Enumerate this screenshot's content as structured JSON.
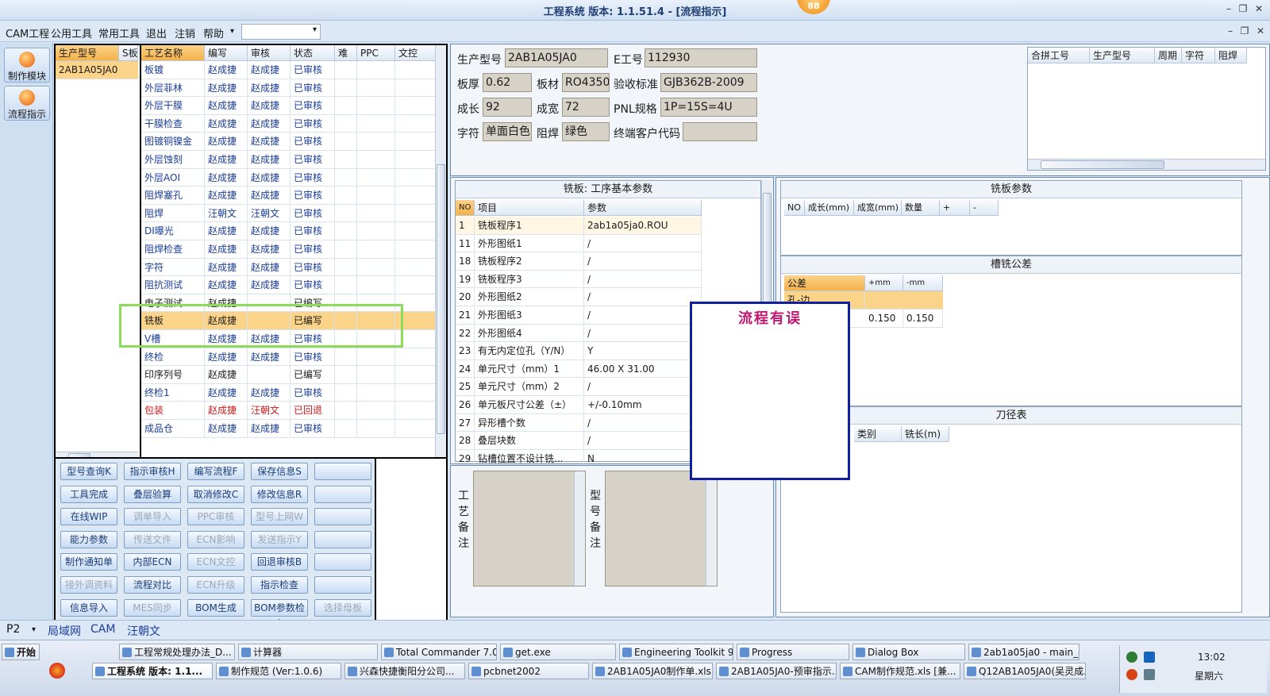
{
  "titlebar": {
    "title": "工程系统  版本: 1.1.51.4 - [流程指示]",
    "badge": "88"
  },
  "menu": [
    "CAM工程",
    "公用工具",
    "常用工具",
    "退出",
    "注销",
    "帮助"
  ],
  "nav": [
    {
      "label": "制作模块"
    },
    {
      "label": "流程指示"
    }
  ],
  "models_panel": {
    "headers": [
      "生产型号",
      "S板"
    ],
    "rows": [
      [
        "2AB1A05JA0"
      ]
    ]
  },
  "process": {
    "headers": [
      "工艺名称",
      "编写",
      "审核",
      "状态",
      "难",
      "PPC",
      "文控"
    ],
    "rows": [
      {
        "name": "板镀",
        "writer": "赵成捷",
        "auditor": "赵成捷",
        "status": "已审核",
        "style": "normal"
      },
      {
        "name": "外层菲林",
        "writer": "赵成捷",
        "auditor": "赵成捷",
        "status": "已审核",
        "style": "normal"
      },
      {
        "name": "外层干膜",
        "writer": "赵成捷",
        "auditor": "赵成捷",
        "status": "已审核",
        "style": "normal"
      },
      {
        "name": "干膜检查",
        "writer": "赵成捷",
        "auditor": "赵成捷",
        "status": "已审核",
        "style": "normal"
      },
      {
        "name": "图镀铜镍金",
        "writer": "赵成捷",
        "auditor": "赵成捷",
        "status": "已审核",
        "style": "normal"
      },
      {
        "name": "外层蚀刻",
        "writer": "赵成捷",
        "auditor": "赵成捷",
        "status": "已审核",
        "style": "normal"
      },
      {
        "name": "外层AOI",
        "writer": "赵成捷",
        "auditor": "赵成捷",
        "status": "已审核",
        "style": "normal"
      },
      {
        "name": "阻焊塞孔",
        "writer": "赵成捷",
        "auditor": "赵成捷",
        "status": "已审核",
        "style": "normal"
      },
      {
        "name": "阻焊",
        "writer": "汪朝文",
        "auditor": "汪朝文",
        "status": "已审核",
        "style": "normal"
      },
      {
        "name": "DI曝光",
        "writer": "赵成捷",
        "auditor": "赵成捷",
        "status": "已审核",
        "style": "normal"
      },
      {
        "name": "阻焊检查",
        "writer": "赵成捷",
        "auditor": "赵成捷",
        "status": "已审核",
        "style": "normal"
      },
      {
        "name": "字符",
        "writer": "赵成捷",
        "auditor": "赵成捷",
        "status": "已审核",
        "style": "normal"
      },
      {
        "name": "阻抗测试",
        "writer": "赵成捷",
        "auditor": "赵成捷",
        "status": "已审核",
        "style": "normal"
      },
      {
        "name": "电子测试",
        "writer": "赵成捷",
        "auditor": "",
        "status": "已编写",
        "style": "plain"
      },
      {
        "name": "铣板",
        "writer": "赵成捷",
        "auditor": "",
        "status": "已编写",
        "style": "selected"
      },
      {
        "name": "V槽",
        "writer": "赵成捷",
        "auditor": "赵成捷",
        "status": "已审核",
        "style": "normal"
      },
      {
        "name": "终检",
        "writer": "赵成捷",
        "auditor": "赵成捷",
        "status": "已审核",
        "style": "normal"
      },
      {
        "name": "印序列号",
        "writer": "赵成捷",
        "auditor": "",
        "status": "已编写",
        "style": "plain"
      },
      {
        "name": "终检1",
        "writer": "赵成捷",
        "auditor": "赵成捷",
        "status": "已审核",
        "style": "normal"
      },
      {
        "name": "包装",
        "writer": "赵成捷",
        "auditor": "汪朝文",
        "status": "已回退",
        "style": "red"
      },
      {
        "name": "成品仓",
        "writer": "赵成捷",
        "auditor": "赵成捷",
        "status": "已审核",
        "style": "normal"
      }
    ]
  },
  "buttons": [
    [
      "型号查询K",
      "指示审核H",
      "编写流程F",
      "保存信息S",
      ""
    ],
    [
      "工具完成",
      "叠层验算",
      "取消修改C",
      "修改信息R",
      ""
    ],
    [
      "在线WIP",
      "调单导入",
      "PPC审核",
      "型号上网W",
      ""
    ],
    [
      "能力参数",
      "传送文件",
      "ECN影响",
      "发送指示Y",
      ""
    ],
    [
      "制作通知单",
      "内部ECN",
      "ECN文控",
      "回退审核B",
      ""
    ],
    [
      "接外调资料",
      "流程对比",
      "ECN升级",
      "指示检查",
      ""
    ],
    [
      "信息导入",
      "MES同步",
      "BOM生成",
      "BOM参数检查",
      "选择母板"
    ]
  ],
  "disabled_buttons": [
    "调单导入",
    "PPC审核",
    "型号上网W",
    "传送文件",
    "ECN影响",
    "发送指示Y",
    "ECN文控",
    "接外调资料",
    "ECN升级",
    "MES同步",
    "选择母板"
  ],
  "info": {
    "product_model_label": "生产型号",
    "product_model": "2AB1A05JA0",
    "e_no_label": "E工号",
    "e_no": "112930",
    "thickness_label": "板厚",
    "thickness": "0.62",
    "material_label": "板材",
    "material": "RO4350B",
    "standard_label": "验收标准",
    "standard": "GJB362B-2009",
    "length_label": "成长",
    "length": "92",
    "width_label": "成宽",
    "width": "72",
    "pnl_label": "PNL规格",
    "pnl": "1P=15S=4U",
    "char_label": "字符",
    "char": "单面白色",
    "mask_label": "阻焊",
    "mask": "绿色",
    "customer_code_label": "终端客户代码",
    "customer_code": ""
  },
  "combine_table": {
    "headers": [
      "合拼工号",
      "生产型号",
      "周期",
      "字符",
      "阻焊"
    ]
  },
  "routing": {
    "title": "铣板: 工序基本参数",
    "headers": [
      "NO",
      "项目",
      "参数"
    ],
    "rows": [
      {
        "no": "1",
        "item": "铣板程序1",
        "value": "2ab1a05ja0.ROU"
      },
      {
        "no": "11",
        "item": "外形图纸1",
        "value": "/"
      },
      {
        "no": "18",
        "item": "铣板程序2",
        "value": "/"
      },
      {
        "no": "19",
        "item": "铣板程序3",
        "value": "/"
      },
      {
        "no": "20",
        "item": "外形图纸2",
        "value": "/"
      },
      {
        "no": "21",
        "item": "外形图纸3",
        "value": "/"
      },
      {
        "no": "22",
        "item": "外形图纸4",
        "value": "/"
      },
      {
        "no": "23",
        "item": "有无内定位孔（Y/N）",
        "value": "Y"
      },
      {
        "no": "24",
        "item": "单元尺寸（mm）1",
        "value": "46.00 X 31.00"
      },
      {
        "no": "25",
        "item": "单元尺寸（mm）2",
        "value": "/"
      },
      {
        "no": "26",
        "item": "单元板尺寸公差（±）",
        "value": "+/-0.10mm"
      },
      {
        "no": "27",
        "item": "异形槽个数",
        "value": "/"
      },
      {
        "no": "28",
        "item": "叠层块数",
        "value": "/"
      },
      {
        "no": "29",
        "item": "钻槽位置不设计铣...",
        "value": "N"
      }
    ]
  },
  "mill_params": {
    "title": "铣板参数",
    "headers": [
      "NO",
      "成长(mm)",
      "成宽(mm)",
      "数量",
      "+",
      "-"
    ]
  },
  "slot_tolerance": {
    "title": "槽铣公差",
    "headers": [
      "公差",
      "+mm",
      "-mm"
    ],
    "row1": "孔-边",
    "plus": "0.150",
    "minus": "0.150"
  },
  "tool_table": {
    "title": "刀径表",
    "headers": [
      "类别",
      "铣长(m)"
    ]
  },
  "remarks": {
    "process_label": "工艺备注",
    "model_label": "型号备注"
  },
  "dialog": {
    "message": "流程有误"
  },
  "status_tabs": [
    "P2",
    "局域网",
    "CAM",
    "汪朝文"
  ],
  "taskbar": {
    "start": "开始",
    "row1": [
      "工程常规处理办法_D...",
      "计算器",
      "Total Commander 7.0 ...",
      "get.exe",
      "Engineering Toolkit 9.0...",
      "Progress",
      "Dialog Box",
      "2ab1a05ja0 - main_qa"
    ],
    "row2": [
      "工程系统  版本: 1.1...",
      "制作规范 (Ver:1.0.6)",
      "兴森快捷衡阳分公司...",
      "pcbnet2002",
      "2AB1A05JA0制作单.xls ...",
      "2AB1A05JA0-预审指示....",
      "CAM制作规范.xls [兼...",
      "Q12AB1A05JA0(吴灵成..."
    ],
    "time": "13:02",
    "day": "星期六"
  }
}
